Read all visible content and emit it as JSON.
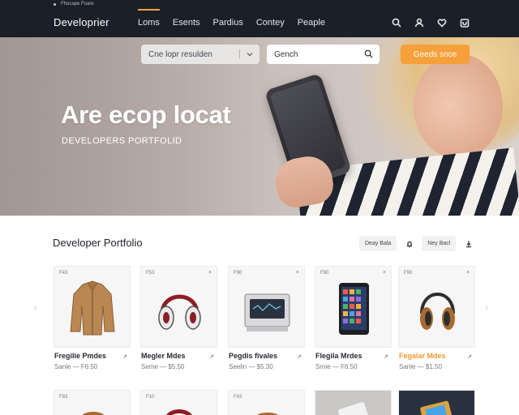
{
  "top_strip": {
    "text": "Fhocape Foare"
  },
  "nav": {
    "brand": "Developrier",
    "links": [
      "Loms",
      "Esents",
      "Pardius",
      "Contey",
      "Peaple"
    ],
    "active_index": 0,
    "icons": [
      "search-icon",
      "user-icon",
      "heart-icon",
      "cart-icon"
    ],
    "accent": "#f4a43a"
  },
  "hero": {
    "select_value": "Cne lopr resulden",
    "search_placeholder": "Gench",
    "cta": "Geeds snce",
    "title": "Are ecop locat",
    "subtitle": "DEVELOPERS PORTFOLID",
    "cta_color": "#f5a03a"
  },
  "section": {
    "title": "Developer Portfolio",
    "tool_left": "Deay Bala",
    "tool_right": "Ney Bacl"
  },
  "products": [
    {
      "tag": "F43",
      "name": "Fregilie Pmdes",
      "price": "Sanle — F6.50",
      "icon": "jacket-icon"
    },
    {
      "tag": "F53",
      "name": "Megler Mdes",
      "price": "Seme — $5.50",
      "icon": "headphones-icon"
    },
    {
      "tag": "F90",
      "name": "Pegdis fivales",
      "price": "Seelin — $5.30",
      "icon": "printer-icon"
    },
    {
      "tag": "F90",
      "name": "Flegila Mrdes",
      "price": "Srnie — F6.50",
      "icon": "tablet-icon"
    },
    {
      "tag": "F90",
      "name": "Fegalar Mdes",
      "price": "Sanle — $1.50",
      "icon": "headphones-icon",
      "highlight": true
    }
  ],
  "products_row2": [
    {
      "tag": "F93"
    },
    {
      "tag": "F10"
    },
    {
      "tag": "F43"
    }
  ]
}
